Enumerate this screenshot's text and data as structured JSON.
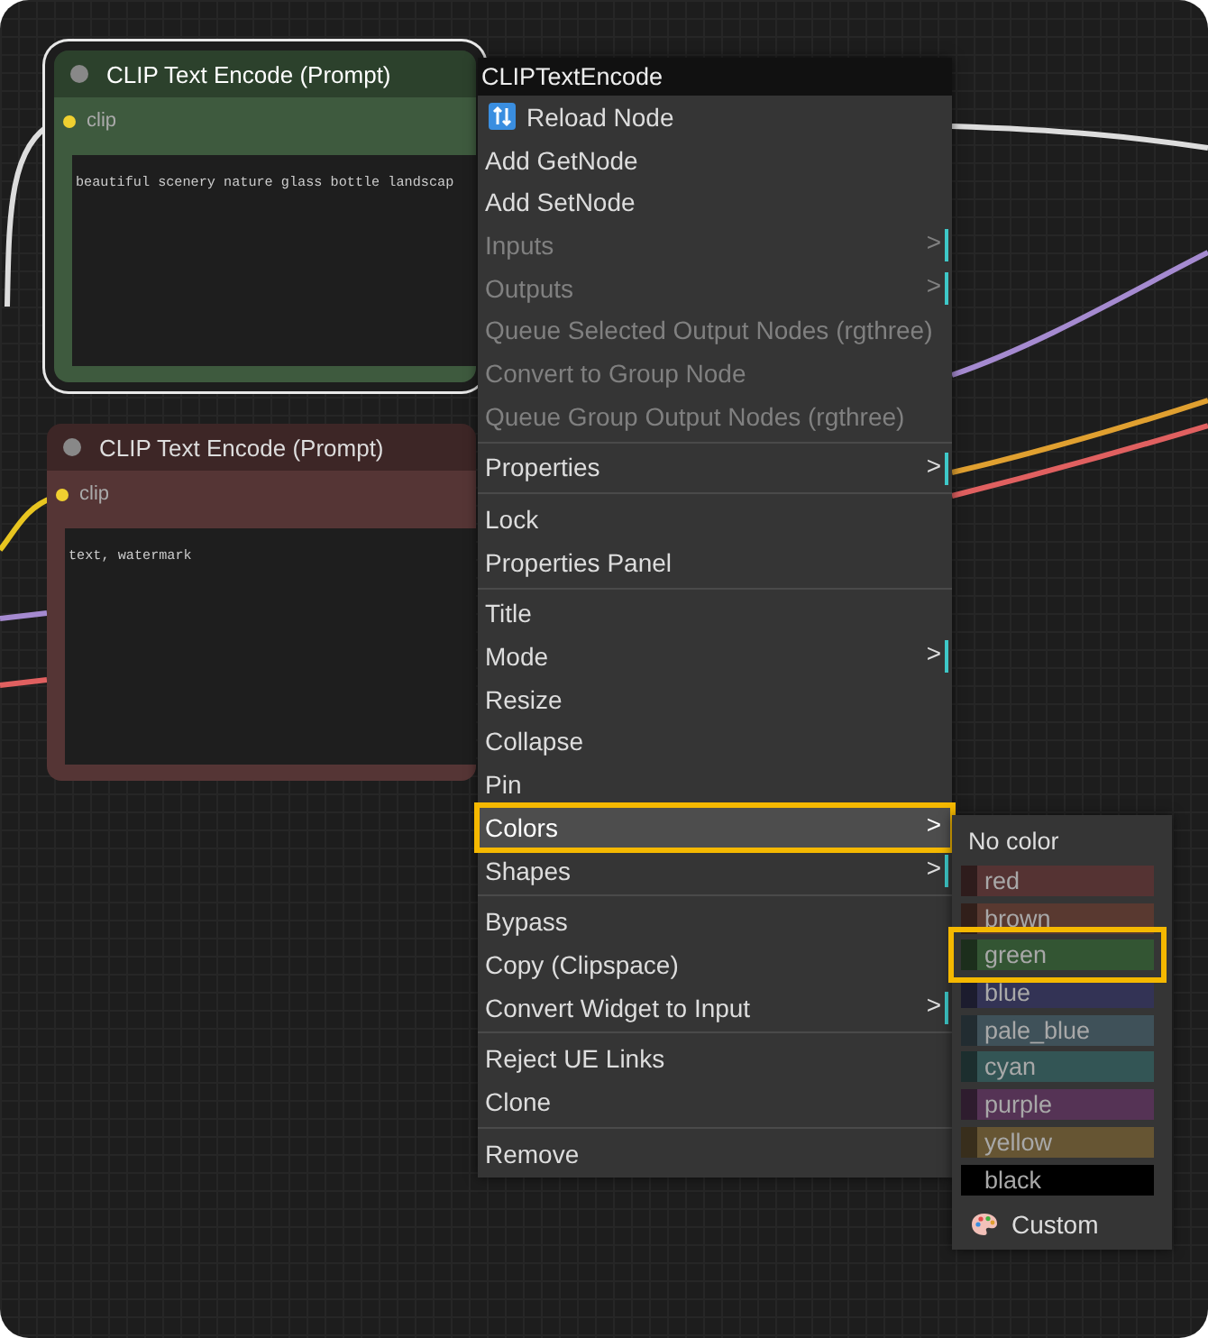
{
  "nodes": [
    {
      "title": "CLIP Text Encode (Prompt)",
      "selected": true,
      "color": "#3e5a3e",
      "input": "clip",
      "text": "beautiful scenery nature glass bottle landscap"
    },
    {
      "title": "CLIP Text Encode (Prompt)",
      "selected": false,
      "color": "#553535",
      "input": "clip",
      "text": "text, watermark"
    }
  ],
  "menu": {
    "title": "CLIPTextEncode",
    "groups": [
      [
        {
          "kind": "with-icon",
          "label": "Reload Node",
          "disabled": false,
          "highlighted": false
        },
        {
          "kind": "plain",
          "label": "Add GetNode",
          "disabled": false,
          "highlighted": false
        },
        {
          "kind": "plain",
          "label": "Add SetNode",
          "disabled": false,
          "highlighted": false
        },
        {
          "kind": "plain",
          "label": "Inputs",
          "disabled": true,
          "highlighted": false,
          "arrow": ">"
        },
        {
          "kind": "plain",
          "label": "Outputs",
          "disabled": true,
          "highlighted": false,
          "arrow": ">"
        },
        {
          "kind": "plain",
          "label": "Queue Selected Output Nodes (rgthree)",
          "disabled": true,
          "highlighted": false
        },
        {
          "kind": "plain",
          "label": "Convert to Group Node",
          "disabled": true,
          "highlighted": false
        },
        {
          "kind": "plain",
          "label": "Queue Group Output Nodes (rgthree)",
          "disabled": true,
          "highlighted": false
        }
      ],
      [
        {
          "kind": "plain",
          "label": "Properties",
          "disabled": false,
          "highlighted": false,
          "arrow": ">"
        }
      ],
      [
        {
          "kind": "plain",
          "label": "Lock",
          "disabled": false,
          "highlighted": false
        },
        {
          "kind": "plain",
          "label": "Properties Panel",
          "disabled": false,
          "highlighted": false
        }
      ],
      [
        {
          "kind": "plain",
          "label": "Title",
          "disabled": false,
          "highlighted": false
        },
        {
          "kind": "plain",
          "label": "Mode",
          "disabled": false,
          "highlighted": false,
          "arrow": ">"
        },
        {
          "kind": "plain",
          "label": "Resize",
          "disabled": false,
          "highlighted": false
        },
        {
          "kind": "plain",
          "label": "Collapse",
          "disabled": false,
          "highlighted": false
        },
        {
          "kind": "plain",
          "label": "Pin",
          "disabled": false,
          "highlighted": false
        },
        {
          "kind": "plain",
          "label": "Colors",
          "disabled": false,
          "highlighted": true,
          "arrow": ">"
        },
        {
          "kind": "plain",
          "label": "Shapes",
          "disabled": false,
          "highlighted": false,
          "arrow": ">"
        }
      ],
      [
        {
          "kind": "plain",
          "label": "Bypass",
          "disabled": false,
          "highlighted": false
        },
        {
          "kind": "plain",
          "label": "Copy (Clipspace)",
          "disabled": false,
          "highlighted": false
        },
        {
          "kind": "plain",
          "label": "Convert Widget to Input",
          "disabled": false,
          "highlighted": false,
          "arrow": ">"
        }
      ],
      [
        {
          "kind": "plain",
          "label": "Reject UE Links",
          "disabled": false,
          "highlighted": false
        },
        {
          "kind": "plain",
          "label": "Clone",
          "disabled": false,
          "highlighted": false
        }
      ],
      [
        {
          "kind": "plain",
          "label": "Remove",
          "disabled": false,
          "highlighted": false
        }
      ]
    ]
  },
  "color_menu": {
    "title": "No color",
    "colors": [
      {
        "label": "red",
        "color": "#553333",
        "highlighted": false
      },
      {
        "label": "brown",
        "color": "#593930",
        "highlighted": false
      },
      {
        "label": "green",
        "color": "#335533",
        "highlighted": true
      },
      {
        "label": "blue",
        "color": "#333355",
        "highlighted": false
      },
      {
        "label": "pale_blue",
        "color": "#3f5159",
        "highlighted": false
      },
      {
        "label": "cyan",
        "color": "#335555",
        "highlighted": false
      },
      {
        "label": "purple",
        "color": "#553355",
        "highlighted": false
      },
      {
        "label": "yellow",
        "color": "#665533",
        "highlighted": false
      },
      {
        "label": "black",
        "color": "#000000",
        "highlighted": false
      }
    ],
    "custom": "Custom"
  }
}
